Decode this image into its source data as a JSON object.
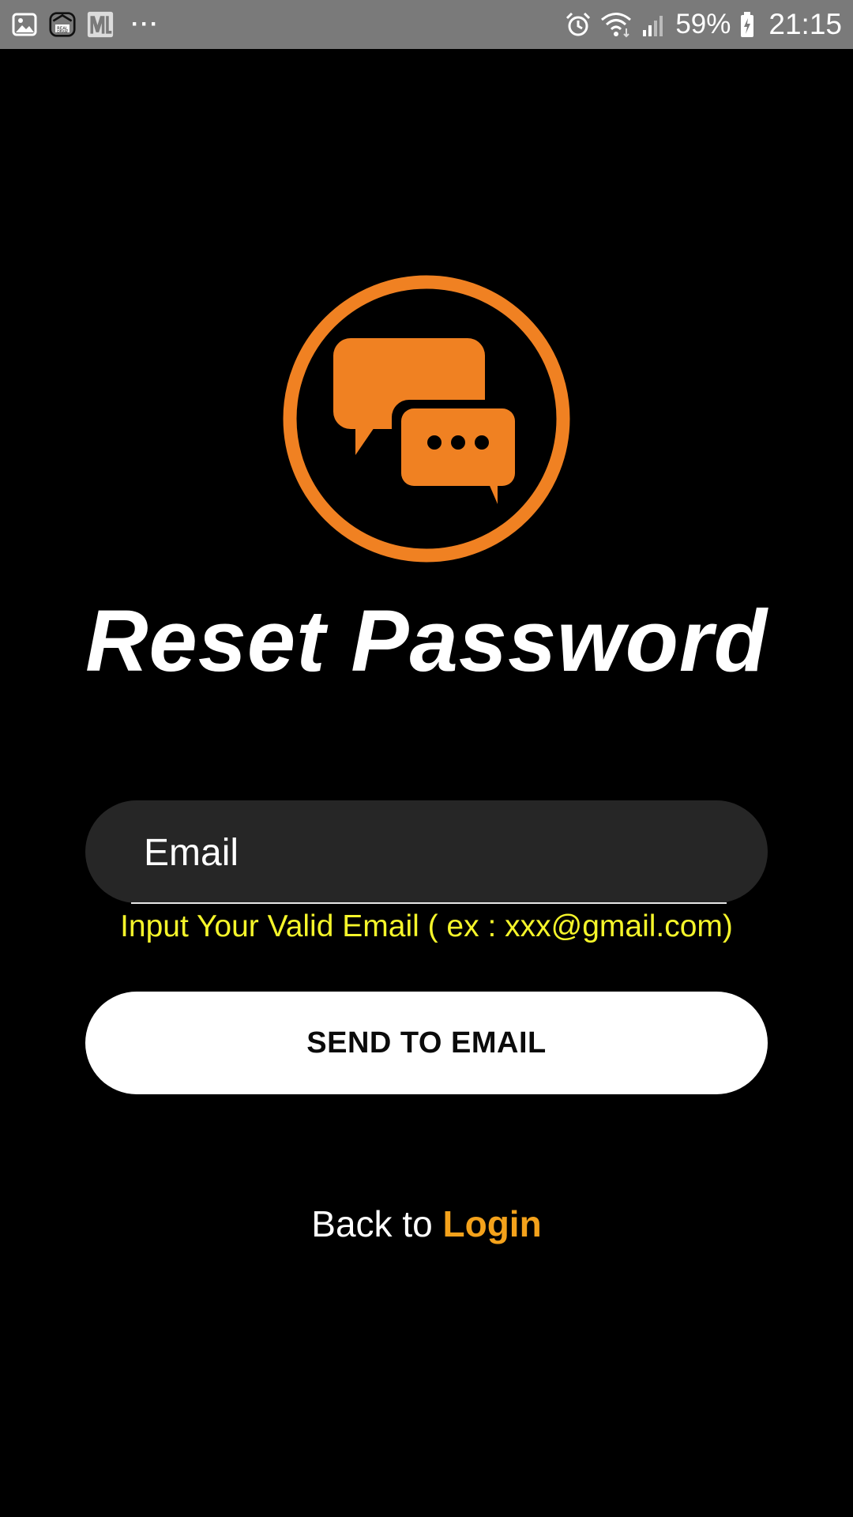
{
  "status_bar": {
    "left_icons": [
      "gallery-icon",
      "realdraw-icon",
      "ml-icon"
    ],
    "more_label": "···",
    "battery_percent": "59%",
    "time": "21:15"
  },
  "title": "Reset Password",
  "email": {
    "placeholder": "Email",
    "value": ""
  },
  "helper_text": "Input Your Valid Email ( ex : xxx@gmail.com)",
  "send_button_label": "SEND TO EMAIL",
  "back": {
    "prefix": "Back to",
    "link_label": "Login"
  },
  "colors": {
    "background": "#000000",
    "status_bar": "#7a7a7a",
    "accent_orange": "#f08122",
    "helper_yellow": "#f5f52a",
    "link_orange": "#f4a21b",
    "field_bg": "#262626"
  }
}
